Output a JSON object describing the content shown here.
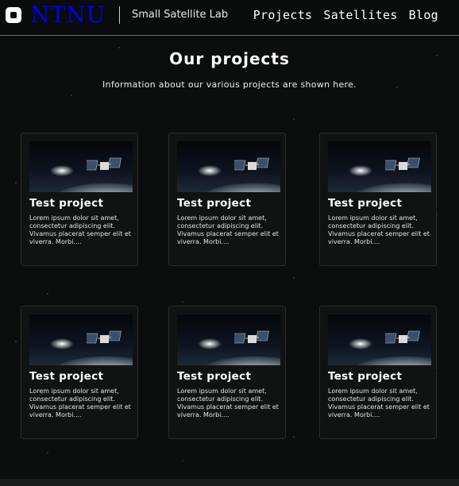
{
  "header": {
    "logo_text": "NTNU",
    "lab_name": "Small Satellite Lab",
    "nav": [
      {
        "label": "Projects"
      },
      {
        "label": "Satellites"
      },
      {
        "label": "Blog"
      }
    ]
  },
  "main": {
    "title": "Our projects",
    "subtitle": "Information about our various projects are shown here.",
    "cards": [
      {
        "title": "Test project",
        "text": "Lorem ipsum dolor sit amet, consectetur adipiscing elit. Vivamus  placerat semper elit et viverra. Morbi...."
      },
      {
        "title": "Test project",
        "text": "Lorem ipsum dolor sit amet, consectetur adipiscing elit. Vivamus  placerat semper elit et viverra. Morbi...."
      },
      {
        "title": "Test project",
        "text": "Lorem ipsum dolor sit amet, consectetur adipiscing elit. Vivamus  placerat semper elit et viverra. Morbi...."
      },
      {
        "title": "Test project",
        "text": "Lorem ipsum dolor sit amet, consectetur adipiscing elit. Vivamus  placerat semper elit et viverra. Morbi...."
      },
      {
        "title": "Test project",
        "text": "Lorem ipsum dolor sit amet, consectetur adipiscing elit. Vivamus  placerat semper elit et viverra. Morbi...."
      },
      {
        "title": "Test project",
        "text": "Lorem ipsum dolor sit amet, consectetur adipiscing elit. Vivamus  placerat semper elit et viverra. Morbi...."
      }
    ]
  },
  "colors": {
    "background": "#0c0d0d",
    "card_background": "#111212",
    "text": "#ffffff"
  }
}
